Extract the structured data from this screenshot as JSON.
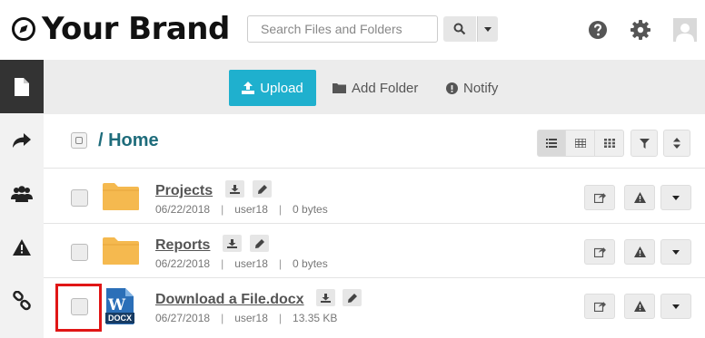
{
  "brand": {
    "name": "Your Brand"
  },
  "search": {
    "placeholder": "Search Files and Folders"
  },
  "header_icons": [
    "search-icon",
    "caret-down-icon",
    "help-icon",
    "gear-icon",
    "user-avatar-icon"
  ],
  "sidebar": {
    "items": [
      {
        "icon": "file-icon",
        "active": true
      },
      {
        "icon": "share-icon",
        "active": false
      },
      {
        "icon": "users-icon",
        "active": false
      },
      {
        "icon": "warning-icon",
        "active": false
      },
      {
        "icon": "link-icon",
        "active": false
      }
    ]
  },
  "toolbar": {
    "upload_label": "Upload",
    "add_folder_label": "Add Folder",
    "notify_label": "Notify"
  },
  "breadcrumb": {
    "path": "/ Home"
  },
  "files": [
    {
      "name": "Projects",
      "type": "folder",
      "date": "06/22/2018",
      "user": "user18",
      "size": "0 bytes"
    },
    {
      "name": "Reports",
      "type": "folder",
      "date": "06/22/2018",
      "user": "user18",
      "size": "0 bytes"
    },
    {
      "name": "Download a File.docx",
      "type": "docx",
      "date": "06/27/2018",
      "user": "user18",
      "size": "13.35 KB",
      "badge": "DOCX"
    }
  ],
  "colors": {
    "accent": "#1fb0ce",
    "folder": "#f5b94f",
    "crumb": "#1e6c7b",
    "highlight": "#e01616"
  }
}
